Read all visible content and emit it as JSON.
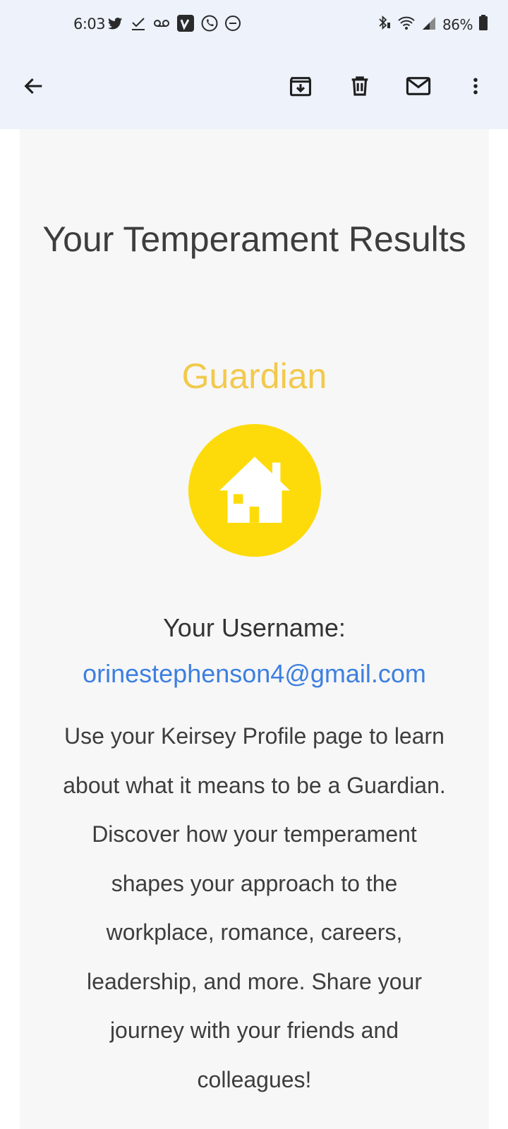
{
  "status_bar": {
    "time": "6:03",
    "battery": "86%",
    "icons_left": [
      "twitter-icon",
      "check-icon",
      "voicemail-icon",
      "vimeo-icon",
      "whatsapp-icon",
      "do-not-disturb-icon"
    ],
    "icons_right": [
      "bluetooth-icon",
      "wifi-icon",
      "signal-icon",
      "battery-icon"
    ]
  },
  "app_bar": {
    "icons": [
      "back-arrow-icon",
      "archive-icon",
      "delete-icon",
      "mark-unread-icon",
      "more-vert-icon"
    ]
  },
  "email": {
    "title": "Your Temperament Results",
    "temperament": "Guardian",
    "username_label": "Your Username:",
    "username_value": "orinestephenson4@gmail.com",
    "description": "Use your Keirsey Profile page to learn about what it means to be a Guardian. Discover how your temperament shapes your approach to the workplace, romance, careers, leadership, and more. Share your journey with your friends and colleagues!"
  },
  "colors": {
    "app_bar_bg": "#edf2fb",
    "guardian_text": "#f2c94c",
    "badge_bg": "#fddb0a",
    "link": "#3d7fe0"
  }
}
